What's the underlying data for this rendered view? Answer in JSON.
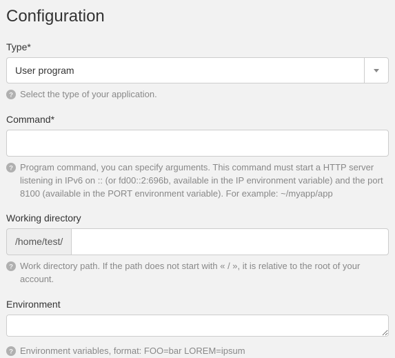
{
  "title": "Configuration",
  "type": {
    "label": "Type*",
    "value": "User program",
    "help": "Select the type of your application."
  },
  "command": {
    "label": "Command*",
    "value": "",
    "help": "Program command, you can specify arguments. This command must start a HTTP server listening in IPv6 on :: (or fd00::2:696b, available in the IP environment variable) and the port 8100 (available in the PORT environment variable). For example: ~/myapp/app"
  },
  "workdir": {
    "label": "Working directory",
    "prefix": "/home/test/",
    "value": "",
    "help": "Work directory path. If the path does not start with « / », it is relative to the root of your account."
  },
  "env": {
    "label": "Environment",
    "value": "",
    "help": "Environment variables, format: FOO=bar LOREM=ipsum"
  }
}
